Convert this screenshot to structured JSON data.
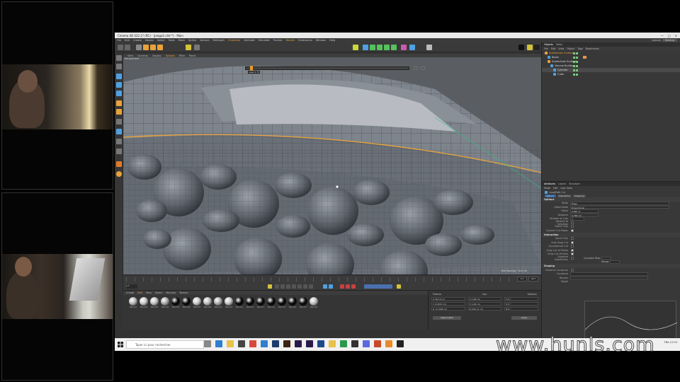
{
  "app": {
    "title": "Cinema 4D S22.1? (RC) - [plage2.c4d *] - Main",
    "window_controls": [
      "—",
      "□",
      "✕"
    ]
  },
  "menubar": [
    "File",
    "Edit",
    "Create",
    "Modes",
    "Select",
    "Tools",
    "Mesh",
    "Spline",
    "Volume",
    "MoGraph",
    "Character",
    "Animate",
    "Simulate",
    "Tracker",
    "Render",
    "Extensions",
    "Window",
    "Help"
  ],
  "layout_selector": {
    "label": "Layout:",
    "value": "Startup"
  },
  "viewport": {
    "menu": [
      "View",
      "Cameras",
      "Display",
      "Options",
      "Filter",
      "Panel"
    ],
    "label": "Perspective",
    "slider_label": "Inset 0.75",
    "hud": "Grid Spacing : 10.0 cm"
  },
  "timeline": {
    "start": "0 F",
    "end": "90 F",
    "current": "0 F"
  },
  "materials": {
    "menu": [
      "Create",
      "Edit",
      "View",
      "Select",
      "Material",
      "Texture"
    ],
    "items": [
      {
        "name": "Mat.001",
        "color": "#b8b8b8"
      },
      {
        "name": "Mat.002",
        "color": "#c8c8c8"
      },
      {
        "name": "Mat.003",
        "color": "#c0c0c0"
      },
      {
        "name": "Mat.004",
        "color": "#a8a8a8"
      },
      {
        "name": "Mat.005",
        "color": "#080808"
      },
      {
        "name": "Mat.006",
        "color": "#080808"
      },
      {
        "name": "Mat.007",
        "color": "#c8c8c8"
      },
      {
        "name": "Mat.008",
        "color": "#bcbcbc"
      },
      {
        "name": "Mat.009",
        "color": "#b0b0b0"
      },
      {
        "name": "Mat.010",
        "color": "#c4c4c4"
      },
      {
        "name": "Mat.011",
        "color": "#080808"
      },
      {
        "name": "Mat.012",
        "color": "#080808"
      },
      {
        "name": "Mat.013",
        "color": "#080808"
      },
      {
        "name": "Mat.014",
        "color": "#080808"
      },
      {
        "name": "Mat.015",
        "color": "#080808"
      },
      {
        "name": "Mat.016",
        "color": "#080808"
      },
      {
        "name": "Mat.017",
        "color": "#0a0a0a"
      },
      {
        "name": "Mat.018",
        "color": "#c0c0c0"
      }
    ]
  },
  "coords": {
    "headers": [
      "Position",
      "Size",
      "Rotation"
    ],
    "rows": [
      {
        "p": "X  48.73 cm",
        "s": "X  1.98 cm",
        "r": "H  0 °"
      },
      {
        "p": "Y  13.837 cm",
        "s": "Y  1.46 cm",
        "r": "P  0 °"
      },
      {
        "p": "Z  -17.004 cm",
        "s": "Z  239.11 cm",
        "r": "B  0 °"
      }
    ],
    "mode": "Object (Rel)",
    "apply": "Apply"
  },
  "objects": {
    "tabs": [
      "Objects",
      "Takes"
    ],
    "menu": [
      "File",
      "Edit",
      "View",
      "Object",
      "Tags",
      "Bookmarks"
    ],
    "items": [
      {
        "name": "Subdivision Surface",
        "color": "#e8a23a"
      },
      {
        "name": "Boole",
        "color": "#4fa0e0"
      },
      {
        "name": "Subdivision Surface",
        "color": "#e8a23a"
      },
      {
        "name": "Volume Builder",
        "color": "#4fa0e0"
      },
      {
        "name": "Cylinder",
        "color": "#4fa0e0"
      },
      {
        "name": "Cube",
        "color": "#4fa0e0"
      }
    ]
  },
  "attributes": {
    "tabs": [
      "Attributes",
      "Layers",
      "Structure"
    ],
    "menu": [
      "Mode",
      "Edit",
      "User Data"
    ],
    "tool": "Loop/Path Cut",
    "subtabs": [
      "Options",
      "Interactive",
      "Snapping"
    ],
    "options_title": "Options",
    "rows": [
      {
        "label": "Mode",
        "value": "Edge"
      },
      {
        "label": "Offset Mode",
        "value": "Proportional"
      },
      {
        "label": "Offset",
        "value": "2.667 %"
      },
      {
        "label": "Distance",
        "value": "4.765 cm"
      },
      {
        "label": "Number of Cuts",
        "value": "1"
      }
    ],
    "checks": [
      "Restrict To Selection",
      "Select Cuts",
      "Connect Cut Edges"
    ],
    "interaction_title": "Interaction",
    "interaction_checks": [
      "Bevel Cuts",
      "Auto Snap Cut",
      "Symmetrical Cut",
      "Snap Cut At Points",
      "Snap Cut At Ends"
    ],
    "quantize": {
      "label": "Quantize Subdivision",
      "step": "Quantize Step",
      "range": "Range"
    },
    "shaping_title": "Shaping",
    "shaping_rows": [
      "Preserve Curvature",
      "Curvature",
      "Tension",
      "Depth"
    ]
  },
  "taskbar": {
    "search_placeholder": "Taper ici pour rechercher",
    "tray": "FRA  12:03"
  },
  "watermark": "www.hunls.com",
  "colors": {
    "accent": "#e8a23a",
    "viewport_bg": "#5a5e63",
    "panel": "#383838"
  }
}
